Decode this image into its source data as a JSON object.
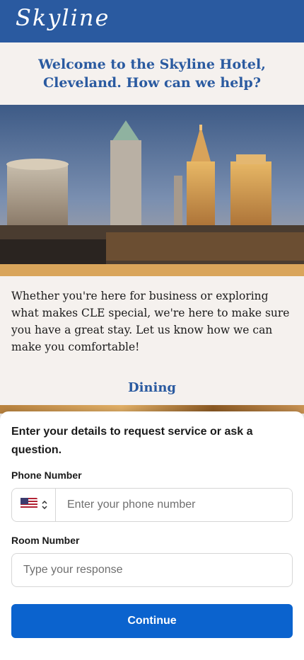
{
  "brand": {
    "logo_text": "Skyline"
  },
  "welcome": {
    "heading": "Welcome to the Skyline Hotel, Cleveland. How can we help?"
  },
  "hero": {
    "image_desc_icon": "city-skyline-photo"
  },
  "intro": {
    "text": "Whether you're here for business or exploring what makes CLE special, we're here to make sure you have a great stay. Let us know how we can make you comfortable!"
  },
  "dining": {
    "label": "Dining"
  },
  "form": {
    "title": "Enter your details to request service or ask a question.",
    "phone_label": "Phone Number",
    "phone_placeholder": "Enter your phone number",
    "country_icon": "us-flag-icon",
    "room_label": "Room Number",
    "room_placeholder": "Type your response",
    "continue_label": "Continue"
  },
  "colors": {
    "brand_blue": "#2a5aa0",
    "button_blue": "#0b63ce",
    "cream": "#f5f1ee"
  }
}
